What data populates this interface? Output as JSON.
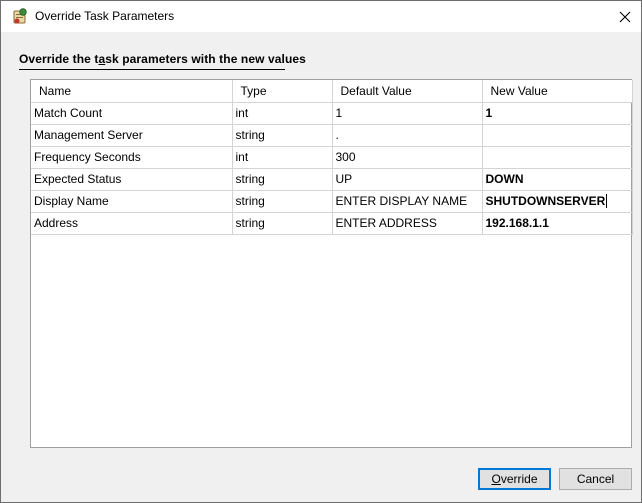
{
  "window": {
    "title": "Override Task Parameters",
    "icon": "task-parameters-app-icon",
    "close_icon": "close-icon"
  },
  "header": {
    "text_pre": "Override the t",
    "text_access_key": "a",
    "text_post": "sk parameters with the new values"
  },
  "grid": {
    "columns": {
      "name": "Name",
      "type": "Type",
      "default_value": "Default Value",
      "new_value": "New Value"
    },
    "rows": [
      {
        "name": "Match Count",
        "type": "int",
        "default_value": "1",
        "new_value": "1"
      },
      {
        "name": "Management Server",
        "type": "string",
        "default_value": ".",
        "new_value": ""
      },
      {
        "name": "Frequency Seconds",
        "type": "int",
        "default_value": "300",
        "new_value": ""
      },
      {
        "name": "Expected Status",
        "type": "string",
        "default_value": "UP",
        "new_value": "DOWN"
      },
      {
        "name": "Display Name",
        "type": "string",
        "default_value": "ENTER DISPLAY NAME",
        "new_value": "SHUTDOWNSERVER"
      },
      {
        "name": "Address",
        "type": "string",
        "default_value": "ENTER ADDRESS",
        "new_value": "192.168.1.1"
      }
    ]
  },
  "buttons": {
    "override_access_key": "O",
    "override_rest": "verride",
    "cancel": "Cancel"
  },
  "colors": {
    "accent_focus": "#0078d7",
    "button_face": "#e1e1e1",
    "dialog_bg": "#f0f0f0"
  }
}
